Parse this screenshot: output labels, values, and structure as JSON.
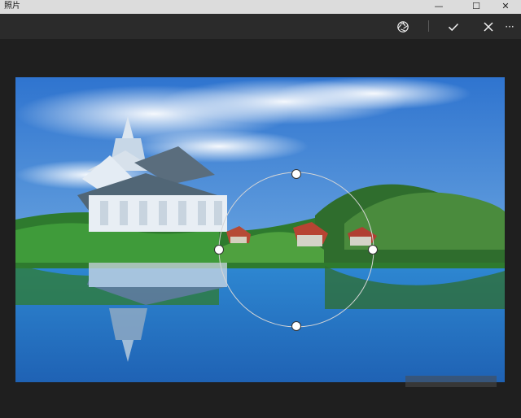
{
  "app": {
    "title": "照片",
    "window": {
      "minimize_label": "—",
      "maximize_label": "☐",
      "close_label": "✕"
    },
    "toolbar": {
      "focus_icon": "aperture-icon",
      "apply_icon": "check-icon",
      "cancel_icon": "close-icon",
      "more_label": "···"
    }
  }
}
